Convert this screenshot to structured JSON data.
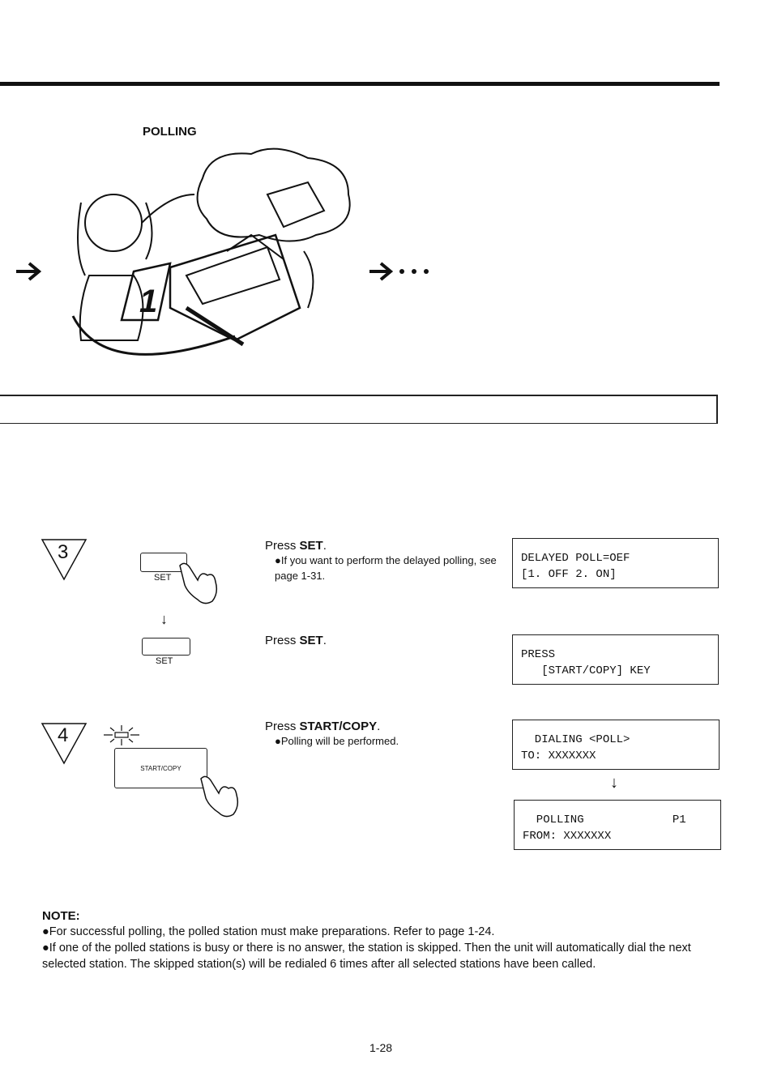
{
  "section_title": "POLLING",
  "steps": [
    {
      "number": "3",
      "actions": [
        {
          "key_label": "SET",
          "instruction_prefix": "Press ",
          "instruction_bold": "SET",
          "instruction_suffix": ".",
          "bullets": [
            "●If you want to perform the delayed polling, see page 1-31."
          ],
          "display": [
            "DELAYED POLL=OEF",
            "[1. OFF 2. ON]"
          ]
        },
        {
          "key_label": "SET",
          "instruction_prefix": "Press ",
          "instruction_bold": "SET",
          "instruction_suffix": ".",
          "bullets": [],
          "display": [
            "PRESS",
            "   [START/COPY] KEY"
          ]
        }
      ]
    },
    {
      "number": "4",
      "actions": [
        {
          "key_label": "START/COPY",
          "instruction_prefix": "Press ",
          "instruction_bold": "START/COPY",
          "instruction_suffix": ".",
          "bullets": [
            "●Polling will be performed."
          ],
          "display": [
            "  DIALING <POLL>",
            "TO: XXXXXXX"
          ]
        }
      ],
      "result_display": [
        "  POLLING             P1",
        "FROM: XXXXXXX"
      ]
    }
  ],
  "note": {
    "heading": "NOTE:",
    "items": [
      "●For successful polling, the polled station must make preparations. Refer to page 1-24.",
      "●If one of the polled stations is busy or there is no answer, the station is skipped. Then the unit will automatically dial the next selected station. The skipped station(s) will be redialed 6 times after all selected stations have been called."
    ]
  },
  "page_number": "1-28"
}
